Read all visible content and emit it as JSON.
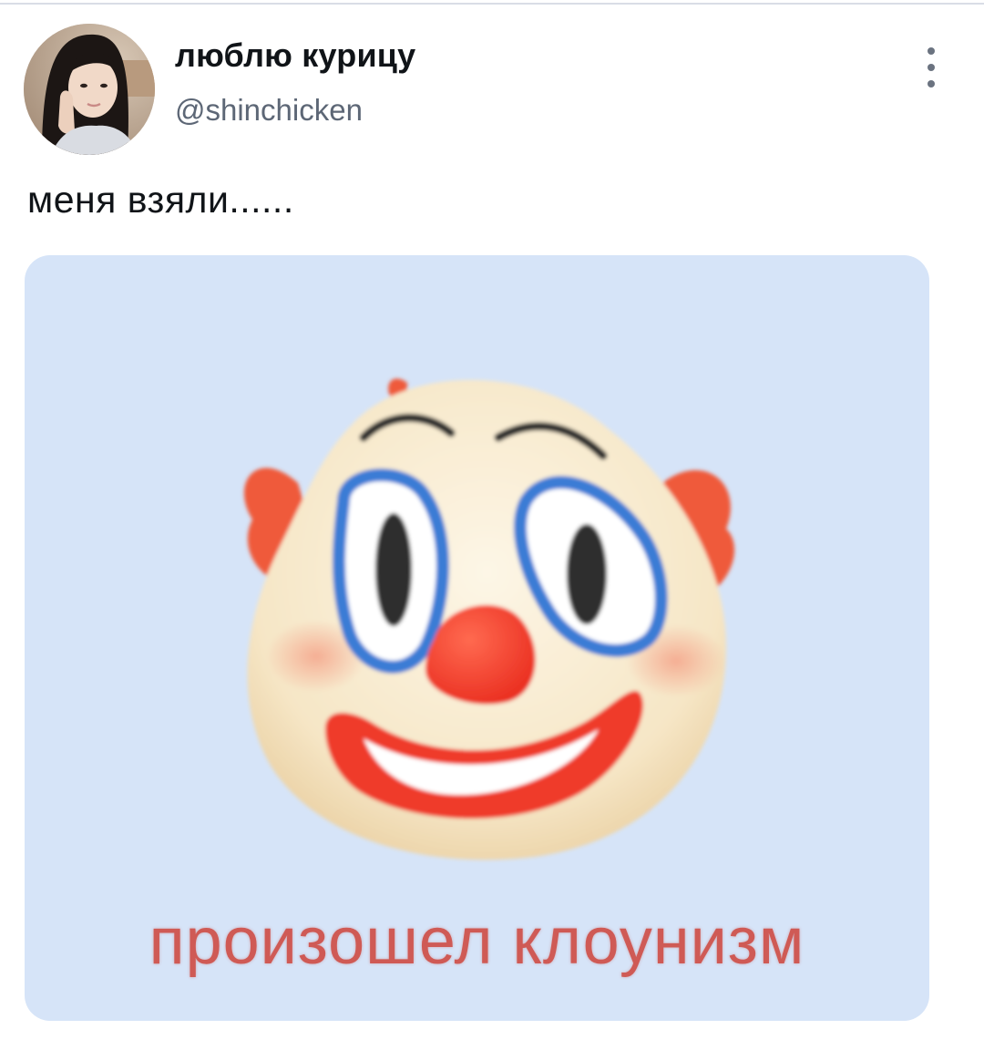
{
  "post": {
    "display_name": "люблю курицу",
    "handle": "@shinchicken",
    "text": "меня взяли......",
    "menu_icon": "more-vertical-icon"
  },
  "media": {
    "image": "clown-face-emoji",
    "caption": "произошел клоунизм",
    "background_color": "#d6e4f8",
    "caption_color": "#cf5a55"
  }
}
